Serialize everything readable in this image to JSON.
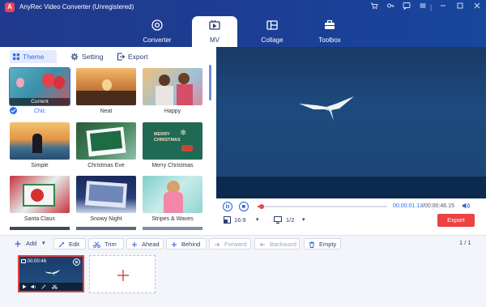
{
  "app": {
    "title": "AnyRec Video Converter (Unregistered)",
    "logo_letter": "A"
  },
  "nav": {
    "converter": "Converter",
    "mv": "MV",
    "collage": "Collage",
    "toolbox": "Toolbox"
  },
  "subtabs": {
    "theme": "Theme",
    "setting": "Setting",
    "export": "Export"
  },
  "themes": [
    {
      "name": "Chic",
      "badge": "Current",
      "selected": true
    },
    {
      "name": "Neat"
    },
    {
      "name": "Happy"
    },
    {
      "name": "Simple"
    },
    {
      "name": "Christmas Eve"
    },
    {
      "name": "Merry Christmas",
      "overlay": "MERRY\nCHRISTMAS"
    },
    {
      "name": "Santa Claus"
    },
    {
      "name": "Snowy Night"
    },
    {
      "name": "Stripes & Waves"
    }
  ],
  "player": {
    "time_current": "00:00:01.13",
    "time_total": "/00:00:46.15",
    "progress": 0.03,
    "aspect_ratio": "16:9",
    "zoom": "1/2",
    "export_label": "Export"
  },
  "toolbar": {
    "add": "Add",
    "edit": "Edit",
    "trim": "Trim",
    "ahead": "Ahead",
    "behind": "Behind",
    "forward": "Forward",
    "backward": "Backward",
    "empty": "Empty",
    "page_current": "1",
    "page_sep": " / ",
    "page_total": "1"
  },
  "clip": {
    "duration": "00:00:46"
  },
  "colors": {
    "accent": "#2f6cf0",
    "export_button": "#ec4242",
    "header": "#213a8e"
  }
}
